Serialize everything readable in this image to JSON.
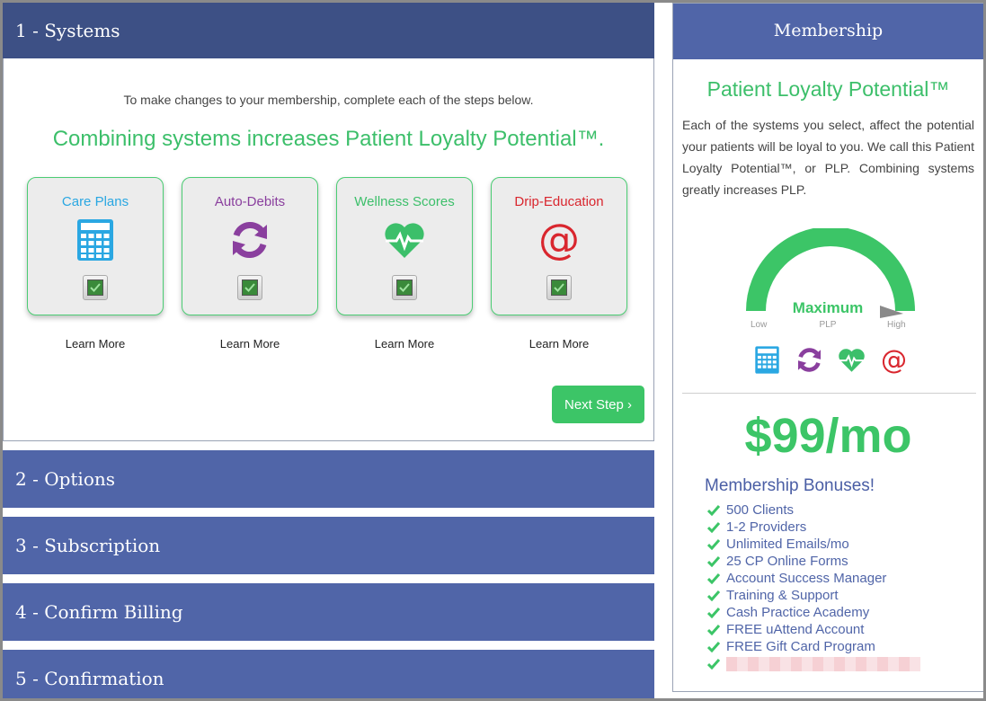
{
  "steps": [
    {
      "label": "1 - Systems"
    },
    {
      "label": "2 - Options"
    },
    {
      "label": "3 - Subscription"
    },
    {
      "label": "4 - Confirm Billing"
    },
    {
      "label": "5 - Confirmation"
    }
  ],
  "systems_panel": {
    "intro": "To make changes to your membership, complete each of the steps below.",
    "headline": "Combining systems increases Patient Loyalty Potential™.",
    "cards": [
      {
        "title": "Care Plans",
        "icon": "calculator-icon",
        "color": "#2aa7e2",
        "learn_more": "Learn More",
        "checked": true
      },
      {
        "title": "Auto-Debits",
        "icon": "sync-icon",
        "color": "#8a3f9e",
        "learn_more": "Learn More",
        "checked": true
      },
      {
        "title": "Wellness Scores",
        "icon": "heartbeat-icon",
        "color": "#3cbf6a",
        "learn_more": "Learn More",
        "checked": true
      },
      {
        "title": "Drip-Education",
        "icon": "at-sign-icon",
        "color": "#d9262e",
        "learn_more": "Learn More",
        "checked": true
      }
    ],
    "next_button": "Next Step ›"
  },
  "membership": {
    "header": "Membership",
    "plp_title": "Patient Loyalty Potential™",
    "plp_description": "Each of the systems you select, affect the potential your patients will be loyal to you. We call this Patient Loyalty Potential™, or PLP. Combining systems greatly increases PLP.",
    "gauge": {
      "value_label": "Maximum",
      "sub_label": "PLP",
      "low": "Low",
      "high": "High",
      "level": 1.0
    },
    "price": "$99/mo",
    "bonuses_title": "Membership Bonuses!",
    "bonuses": [
      "500 Clients",
      "1-2 Providers",
      "Unlimited Emails/mo",
      "25 CP Online Forms",
      "Account Success Manager",
      "Training & Support",
      "Cash Practice Academy",
      "FREE uAttend Account",
      "FREE Gift Card Program"
    ]
  },
  "colors": {
    "header_blue": "#5065a8",
    "header_active": "#3d5085",
    "accent_green": "#3cc567"
  }
}
